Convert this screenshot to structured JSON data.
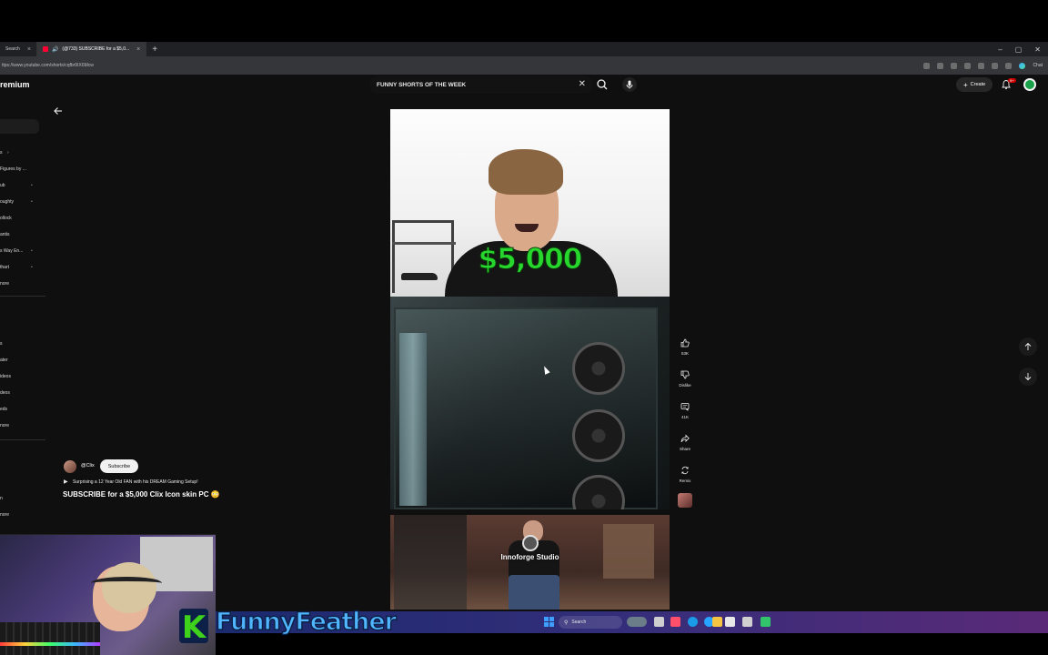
{
  "browser": {
    "tabs": [
      {
        "label": "Search",
        "active": false
      },
      {
        "label": "(@733) SUBSCRIBE for a $5,0...",
        "active": true
      }
    ],
    "url": "ttps://www.youtube.com/shorts/cqfbr9IX6Mcw",
    "profile_label": "Chat"
  },
  "masthead": {
    "logo_text": "remium",
    "search_query": "FUNNY SHORTS OF THE WEEK",
    "create_label": "Create",
    "notification_count": "9+"
  },
  "sidebar": {
    "items": [
      {
        "label": "s",
        "plus": false
      },
      {
        "label": "Figures by ...",
        "plus": false
      },
      {
        "label": "ub",
        "plus": true
      },
      {
        "label": "oughty",
        "plus": true
      },
      {
        "label": "ollock",
        "plus": false
      },
      {
        "label": "antis",
        "plus": false
      },
      {
        "label": "s Way En...",
        "plus": true
      },
      {
        "label": "thart",
        "plus": true
      },
      {
        "label": "nore",
        "plus": false
      }
    ],
    "items2": [
      {
        "label": "s"
      },
      {
        "label": "ater"
      },
      {
        "label": "ideos"
      },
      {
        "label": "deos"
      },
      {
        "label": "eds"
      },
      {
        "label": "nore"
      }
    ],
    "items3": [
      {
        "label": "n"
      },
      {
        "label": "nore"
      }
    ]
  },
  "short": {
    "channel": "@Clix",
    "subscribe_label": "Subscribe",
    "playlist_line": "Surprising a 12 Year Old FAN with his DREAM Gaming Setup!",
    "title": "SUBSCRIBE for a $5,000 Clix Icon skin PC 😳",
    "caption": "$5,000"
  },
  "actions": {
    "like_count": "53K",
    "dislike_label": "Dislike",
    "comments_count": "41K",
    "share_label": "Share",
    "remix_label": "Remix"
  },
  "next_short": {
    "overlay_text": "Innoforge Studio"
  },
  "stream_overlay": {
    "brand_letter": "K",
    "brand_name": "FunnyFeather"
  },
  "taskbar": {
    "search_label": "Search"
  },
  "colors": {
    "caption_green": "#27d72d",
    "brand_blue": "#4fb6ff",
    "brand_green": "#3fd21c",
    "yt_red": "#ff0033"
  }
}
